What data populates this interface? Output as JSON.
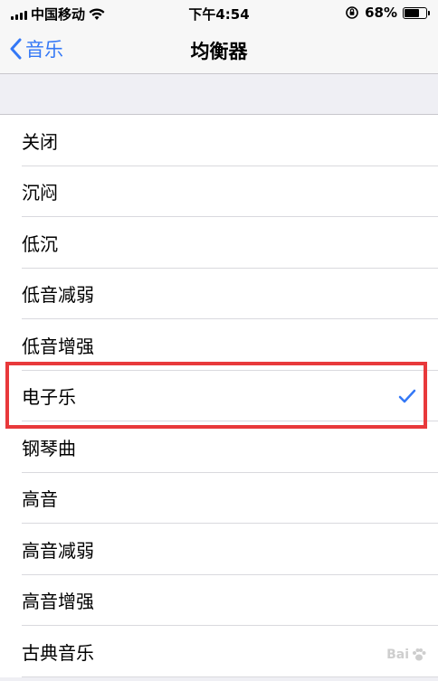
{
  "status_bar": {
    "carrier": "中国移动",
    "time": "下午4:54",
    "battery": "68%",
    "battery_level": 0.68
  },
  "nav": {
    "back_label": "音乐",
    "title": "均衡器"
  },
  "list": {
    "items": [
      {
        "label": "关闭"
      },
      {
        "label": "沉闷"
      },
      {
        "label": "低沉"
      },
      {
        "label": "低音减弱"
      },
      {
        "label": "低音增强"
      },
      {
        "label": "电子乐",
        "selected": true
      },
      {
        "label": "钢琴曲"
      },
      {
        "label": "高音"
      },
      {
        "label": "高音减弱"
      },
      {
        "label": "高音增强"
      },
      {
        "label": "古典音乐"
      }
    ]
  },
  "colors": {
    "accent": "#3478f6",
    "highlight": "#e8393b",
    "background": "#efeff4"
  },
  "icons": {
    "back": "chevron-left-icon",
    "selected": "checkmark-icon"
  }
}
